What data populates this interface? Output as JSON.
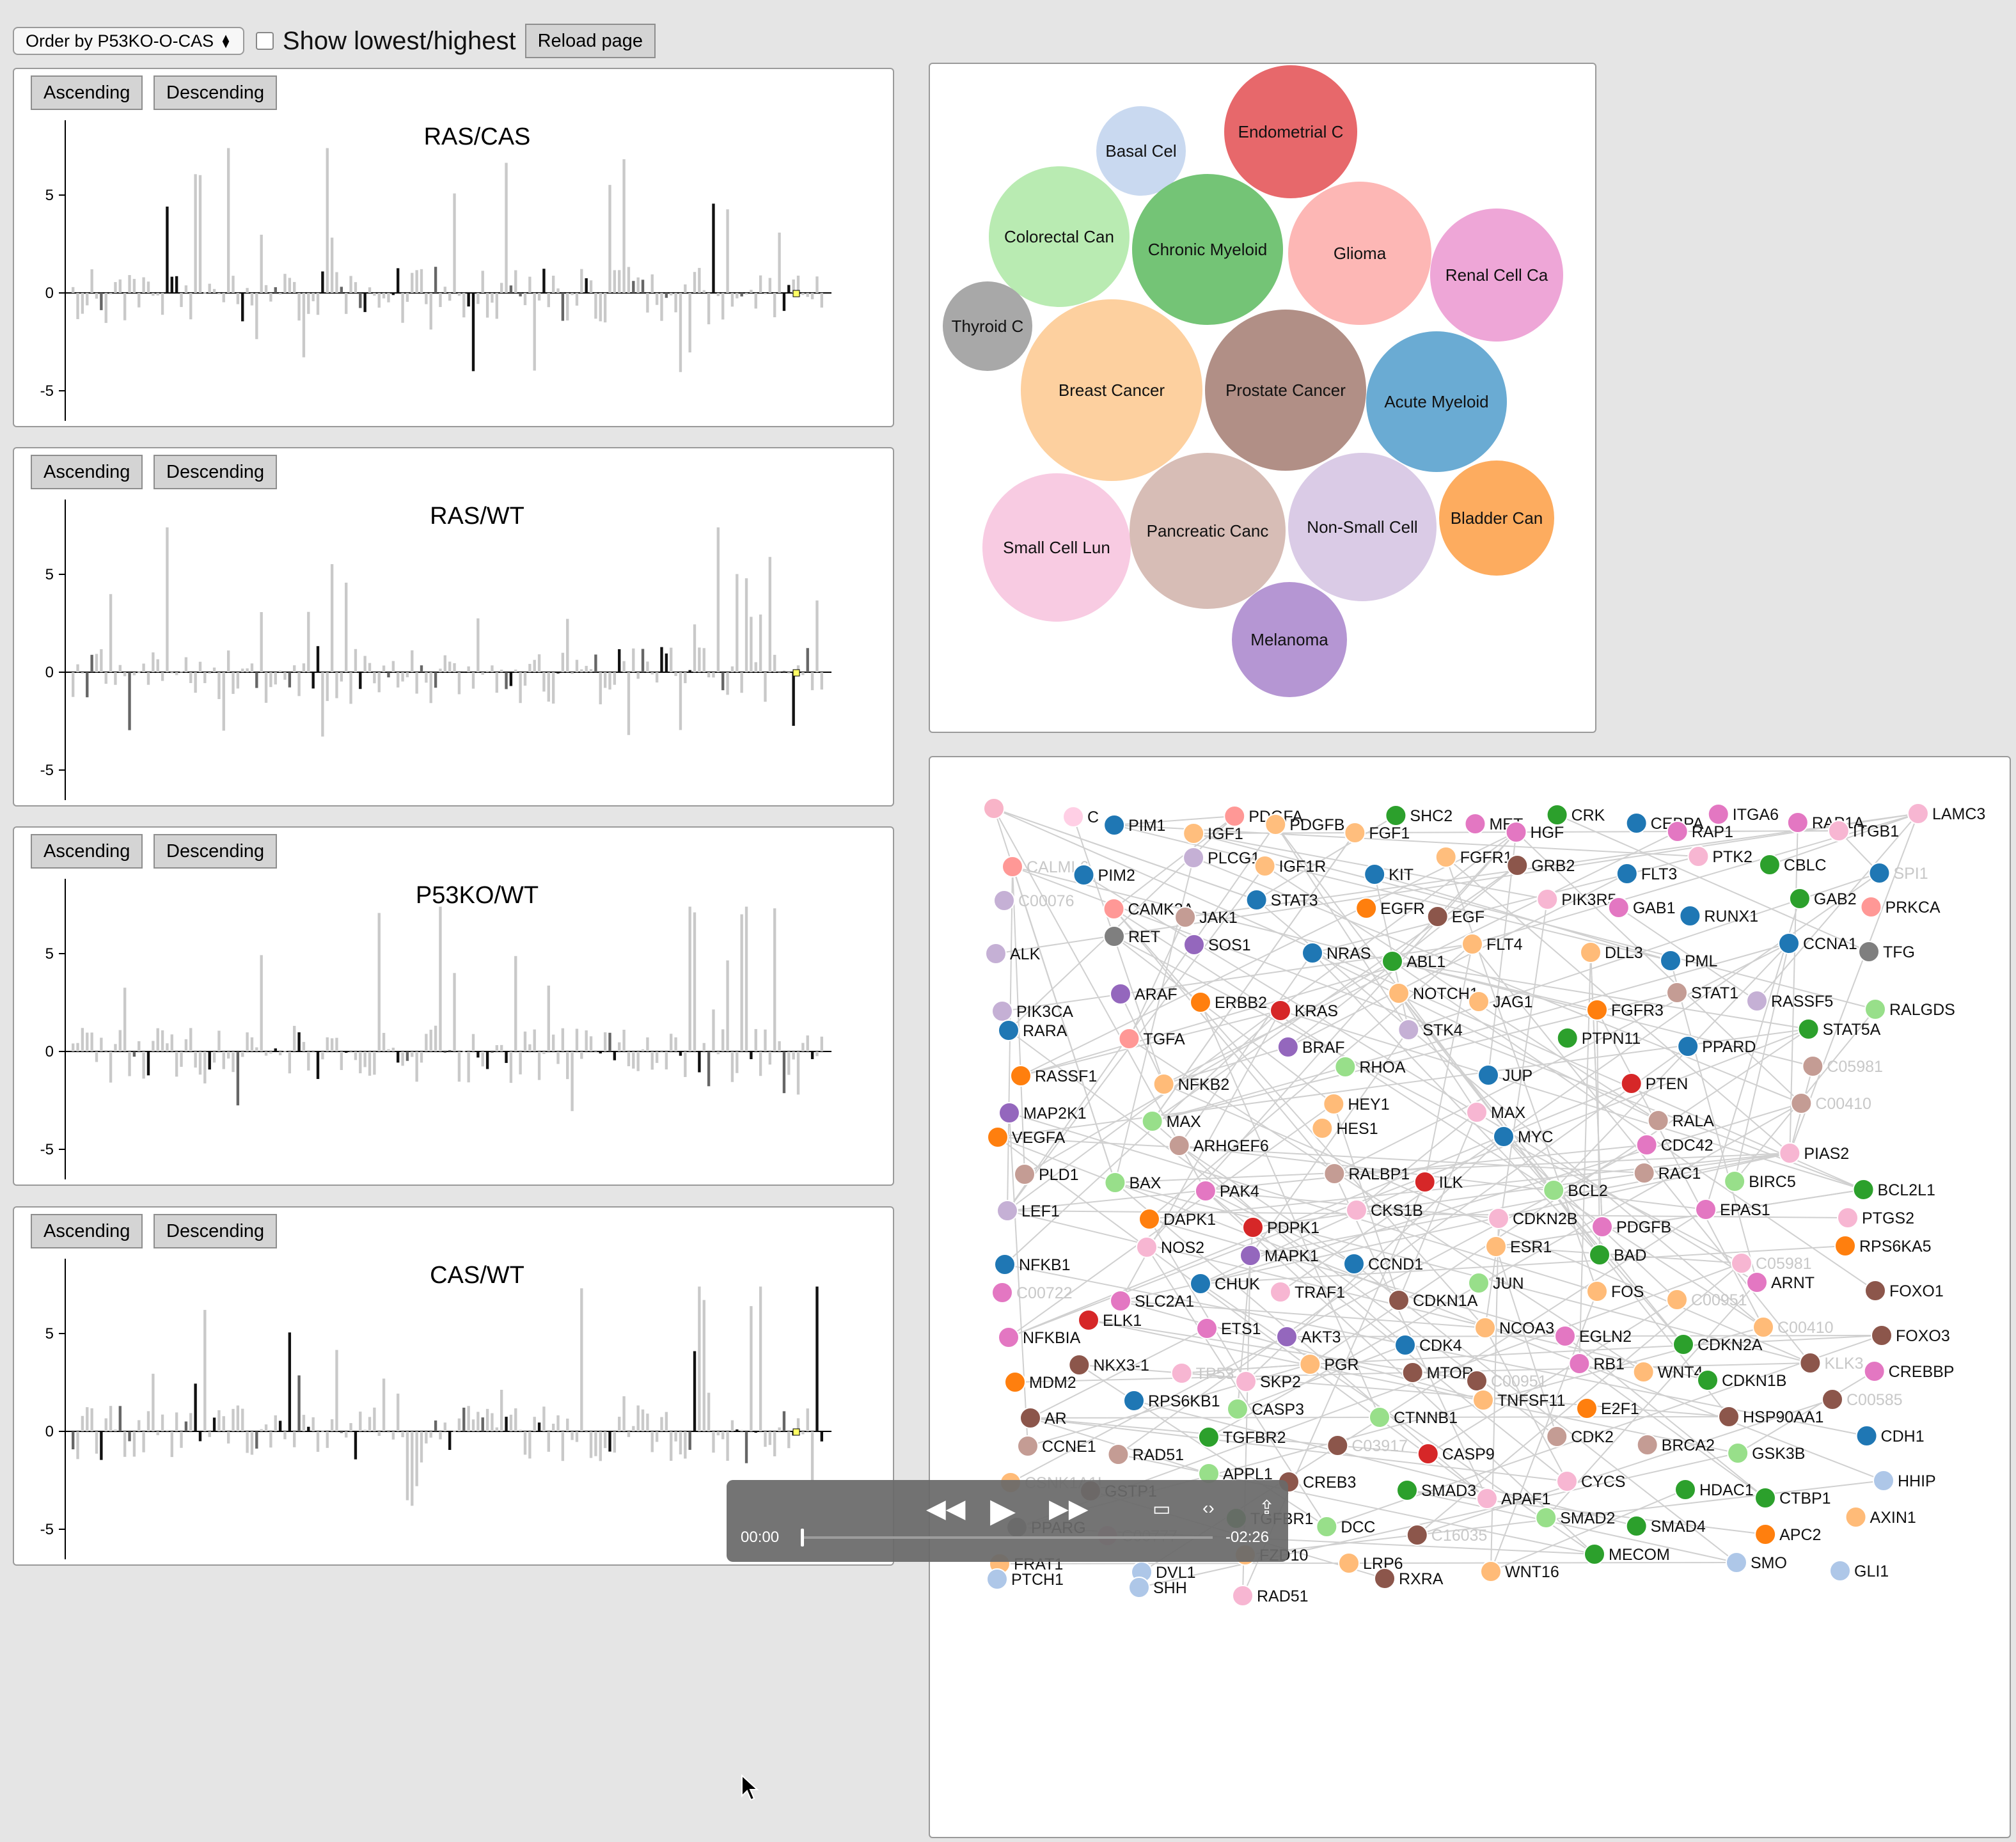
{
  "toolbar": {
    "order_select": "Order by P53KO-O-CAS",
    "show_label": "Show lowest/highest",
    "reload": "Reload page"
  },
  "panels": [
    {
      "id": "ras-cas",
      "title": "RAS/CAS",
      "asc": "Ascending",
      "desc": "Descending"
    },
    {
      "id": "ras-wt",
      "title": "RAS/WT",
      "asc": "Ascending",
      "desc": "Descending"
    },
    {
      "id": "p53ko-wt",
      "title": "P53KO/WT",
      "asc": "Ascending",
      "desc": "Descending"
    },
    {
      "id": "cas-wt",
      "title": "CAS/WT",
      "asc": "Ascending",
      "desc": "Descending"
    }
  ],
  "chart_data": [
    {
      "type": "bar",
      "title": "RAS/CAS",
      "ylim": [
        -8,
        8
      ],
      "yticks": [
        5,
        0,
        -5
      ],
      "seed": 11,
      "highlight": 1
    },
    {
      "type": "bar",
      "title": "RAS/WT",
      "ylim": [
        -8,
        8
      ],
      "yticks": [
        5,
        0,
        -5
      ],
      "seed": 23,
      "highlight": 1
    },
    {
      "type": "bar",
      "title": "P53KO/WT",
      "ylim": [
        -8,
        8
      ],
      "yticks": [
        5,
        0,
        -5
      ],
      "seed": 37,
      "highlight": 0
    },
    {
      "type": "bar",
      "title": "CAS/WT",
      "ylim": [
        -8,
        8
      ],
      "yticks": [
        5,
        0,
        -5
      ],
      "seed": 51,
      "highlight": 1
    }
  ],
  "bubbles": [
    {
      "label": "Endometrial C",
      "color": "#e7686b"
    },
    {
      "label": "Basal Cel",
      "color": "#c9d9f0"
    },
    {
      "label": "Colorectal Can",
      "color": "#b9ebb2"
    },
    {
      "label": "Chronic Myeloid",
      "color": "#74c476"
    },
    {
      "label": "Glioma",
      "color": "#fdb7b5"
    },
    {
      "label": "Renal Cell Ca",
      "color": "#eea6d7"
    },
    {
      "label": "Thyroid C",
      "color": "#a8a8a8"
    },
    {
      "label": "Breast Cancer",
      "color": "#fdd09f"
    },
    {
      "label": "Prostate Cancer",
      "color": "#b18f86"
    },
    {
      "label": "Acute Myeloid",
      "color": "#6aabd3"
    },
    {
      "label": "Small Cell Lun",
      "color": "#f8cbe2"
    },
    {
      "label": "Pancreatic Canc",
      "color": "#d7bdb6"
    },
    {
      "label": "Non-Small Cell",
      "color": "#dacbe6"
    },
    {
      "label": "Bladder Can",
      "color": "#fdac5f"
    },
    {
      "label": "Melanoma",
      "color": "#b596d3"
    }
  ],
  "network_nodes": [
    {
      "label": "",
      "color": "#f8b4c8"
    },
    {
      "label": "C",
      "color": "#ffcfe5"
    },
    {
      "label": "PIM1",
      "color": "#1f77b4"
    },
    {
      "label": "IGF1",
      "color": "#ffbe7d"
    },
    {
      "label": "PDGFA",
      "color": "#ff9896"
    },
    {
      "label": "PDGFB",
      "color": "#ffbe7d"
    },
    {
      "label": "FGF1",
      "color": "#ffbe7d"
    },
    {
      "label": "SHC2",
      "color": "#2ca02c"
    },
    {
      "label": "MET",
      "color": "#e377c2"
    },
    {
      "label": "HGF",
      "color": "#e377c2"
    },
    {
      "label": "CRK",
      "color": "#2ca02c"
    },
    {
      "label": "CEBPA",
      "color": "#1f77b4"
    },
    {
      "label": "RAP1",
      "color": "#e377c2"
    },
    {
      "label": "ITGA6",
      "color": "#e377c2"
    },
    {
      "label": "RAP1A",
      "color": "#e377c2"
    },
    {
      "label": "ITGB1",
      "color": "#f7b6d2"
    },
    {
      "label": "LAMC3",
      "color": "#f7b6d2"
    },
    {
      "label": "CALML6",
      "color": "#ff9896"
    },
    {
      "label": "PIM2",
      "color": "#1f77b4"
    },
    {
      "label": "PLCG1",
      "color": "#c5b0d5"
    },
    {
      "label": "IGF1R",
      "color": "#ffbe7d"
    },
    {
      "label": "KIT",
      "color": "#1f77b4"
    },
    {
      "label": "FGFR1",
      "color": "#ffbe7d"
    },
    {
      "label": "GRB2",
      "color": "#8c564b"
    },
    {
      "label": "FLT3",
      "color": "#1f77b4"
    },
    {
      "label": "PTK2",
      "color": "#f7b6d2"
    },
    {
      "label": "CBLC",
      "color": "#2ca02c"
    },
    {
      "label": "SPI1",
      "color": "#1f77b4"
    },
    {
      "label": "C00076",
      "color": "#c5b0d5"
    },
    {
      "label": "CAMK2A",
      "color": "#ff9896"
    },
    {
      "label": "JAK1",
      "color": "#c49c94"
    },
    {
      "label": "STAT3",
      "color": "#1f77b4"
    },
    {
      "label": "EGFR",
      "color": "#ff7f0e"
    },
    {
      "label": "EGF",
      "color": "#8c564b"
    },
    {
      "label": "PIK3R5",
      "color": "#f7b6d2"
    },
    {
      "label": "GAB1",
      "color": "#e377c2"
    },
    {
      "label": "RUNX1",
      "color": "#1f77b4"
    },
    {
      "label": "GAB2",
      "color": "#2ca02c"
    },
    {
      "label": "PRKCA",
      "color": "#ff9896"
    },
    {
      "label": "ALK",
      "color": "#c5b0d5"
    },
    {
      "label": "RET",
      "color": "#7f7f7f"
    },
    {
      "label": "SOS1",
      "color": "#9467bd"
    },
    {
      "label": "NRAS",
      "color": "#1f77b4"
    },
    {
      "label": "ABL1",
      "color": "#2ca02c"
    },
    {
      "label": "FLT4",
      "color": "#ffbb78"
    },
    {
      "label": "DLL3",
      "color": "#ffbb78"
    },
    {
      "label": "PML",
      "color": "#1f77b4"
    },
    {
      "label": "CCNA1",
      "color": "#1f77b4"
    },
    {
      "label": "TFG",
      "color": "#7f7f7f"
    },
    {
      "label": "PIK3CA",
      "color": "#c5b0d5"
    },
    {
      "label": "ARAF",
      "color": "#9467bd"
    },
    {
      "label": "ERBB2",
      "color": "#ff7f0e"
    },
    {
      "label": "KRAS",
      "color": "#d62728"
    },
    {
      "label": "NOTCH1",
      "color": "#ffbb78"
    },
    {
      "label": "JAG1",
      "color": "#ffbb78"
    },
    {
      "label": "FGFR3",
      "color": "#ff7f0e"
    },
    {
      "label": "STAT1",
      "color": "#c49c94"
    },
    {
      "label": "RASSF5",
      "color": "#c5b0d5"
    },
    {
      "label": "RALGDS",
      "color": "#98df8a"
    },
    {
      "label": "RARA",
      "color": "#1f77b4"
    },
    {
      "label": "TGFA",
      "color": "#ff9896"
    },
    {
      "label": "BRAF",
      "color": "#9467bd"
    },
    {
      "label": "STK4",
      "color": "#c5b0d5"
    },
    {
      "label": "PTPN11",
      "color": "#2ca02c"
    },
    {
      "label": "PPARD",
      "color": "#1f77b4"
    },
    {
      "label": "STAT5A",
      "color": "#2ca02c"
    },
    {
      "label": "RASSF1",
      "color": "#ff7f0e"
    },
    {
      "label": "NFKB2",
      "color": "#ffbb78"
    },
    {
      "label": "RHOA",
      "color": "#98df8a"
    },
    {
      "label": "JUP",
      "color": "#1f77b4"
    },
    {
      "label": "PTEN",
      "color": "#d62728"
    },
    {
      "label": "C05981",
      "color": "#c49c94"
    },
    {
      "label": "MAP2K1",
      "color": "#9467bd"
    },
    {
      "label": "MAX",
      "color": "#98df8a"
    },
    {
      "label": "HEY1",
      "color": "#ffbb78"
    },
    {
      "label": "MAX",
      "color": "#f7b6d2"
    },
    {
      "label": "RALA",
      "color": "#c49c94"
    },
    {
      "label": "C00410",
      "color": "#c49c94"
    },
    {
      "label": "VEGFA",
      "color": "#ff7f0e"
    },
    {
      "label": "ARHGEF6",
      "color": "#c49c94"
    },
    {
      "label": "HES1",
      "color": "#ffbb78"
    },
    {
      "label": "MYC",
      "color": "#1f77b4"
    },
    {
      "label": "CDC42",
      "color": "#e377c2"
    },
    {
      "label": "PIAS2",
      "color": "#f7b6d2"
    },
    {
      "label": "PLD1",
      "color": "#c49c94"
    },
    {
      "label": "BAX",
      "color": "#98df8a"
    },
    {
      "label": "PAK4",
      "color": "#e377c2"
    },
    {
      "label": "RALBP1",
      "color": "#c49c94"
    },
    {
      "label": "ILK",
      "color": "#d62728"
    },
    {
      "label": "BCL2",
      "color": "#98df8a"
    },
    {
      "label": "RAC1",
      "color": "#c49c94"
    },
    {
      "label": "BIRC5",
      "color": "#98df8a"
    },
    {
      "label": "BCL2L1",
      "color": "#2ca02c"
    },
    {
      "label": "LEF1",
      "color": "#c5b0d5"
    },
    {
      "label": "DAPK1",
      "color": "#ff7f0e"
    },
    {
      "label": "PDPK1",
      "color": "#d62728"
    },
    {
      "label": "CKS1B",
      "color": "#f7b6d2"
    },
    {
      "label": "CDKN2B",
      "color": "#f7b6d2"
    },
    {
      "label": "PDGFB",
      "color": "#e377c2"
    },
    {
      "label": "EPAS1",
      "color": "#e377c2"
    },
    {
      "label": "PTGS2",
      "color": "#f7b6d2"
    },
    {
      "label": "NFKB1",
      "color": "#1f77b4"
    },
    {
      "label": "NOS2",
      "color": "#f7b6d2"
    },
    {
      "label": "MAPK1",
      "color": "#9467bd"
    },
    {
      "label": "CCND1",
      "color": "#1f77b4"
    },
    {
      "label": "ESR1",
      "color": "#ffbb78"
    },
    {
      "label": "BAD",
      "color": "#2ca02c"
    },
    {
      "label": "C05981",
      "color": "#f7b6d2"
    },
    {
      "label": "RPS6KA5",
      "color": "#ff7f0e"
    },
    {
      "label": "C00722",
      "color": "#e377c2"
    },
    {
      "label": "SLC2A1",
      "color": "#e377c2"
    },
    {
      "label": "CHUK",
      "color": "#1f77b4"
    },
    {
      "label": "TRAF1",
      "color": "#f7b6d2"
    },
    {
      "label": "CDKN1A",
      "color": "#8c564b"
    },
    {
      "label": "JUN",
      "color": "#98df8a"
    },
    {
      "label": "FOS",
      "color": "#ffbb78"
    },
    {
      "label": "C00951",
      "color": "#ffbb78"
    },
    {
      "label": "ARNT",
      "color": "#e377c2"
    },
    {
      "label": "FOXO1",
      "color": "#8c564b"
    },
    {
      "label": "NFKBIA",
      "color": "#e377c2"
    },
    {
      "label": "ELK1",
      "color": "#d62728"
    },
    {
      "label": "ETS1",
      "color": "#e377c2"
    },
    {
      "label": "AKT3",
      "color": "#9467bd"
    },
    {
      "label": "CDK4",
      "color": "#1f77b4"
    },
    {
      "label": "NCOA3",
      "color": "#ffbb78"
    },
    {
      "label": "EGLN2",
      "color": "#e377c2"
    },
    {
      "label": "CDKN2A",
      "color": "#2ca02c"
    },
    {
      "label": "C00410",
      "color": "#ffbb78"
    },
    {
      "label": "FOXO3",
      "color": "#8c564b"
    },
    {
      "label": "MDM2",
      "color": "#ff7f0e"
    },
    {
      "label": "NKX3-1",
      "color": "#8c564b"
    },
    {
      "label": "TP53",
      "color": "#f7b6d2"
    },
    {
      "label": "SKP2",
      "color": "#f7b6d2"
    },
    {
      "label": "PGR",
      "color": "#ffbb78"
    },
    {
      "label": "MTOR",
      "color": "#8c564b"
    },
    {
      "label": "C00951",
      "color": "#8c564b"
    },
    {
      "label": "RB1",
      "color": "#e377c2"
    },
    {
      "label": "WNT4",
      "color": "#ffbb78"
    },
    {
      "label": "CDKN1B",
      "color": "#2ca02c"
    },
    {
      "label": "KLK3",
      "color": "#8c564b"
    },
    {
      "label": "CREBBP",
      "color": "#e377c2"
    },
    {
      "label": "AR",
      "color": "#8c564b"
    },
    {
      "label": "RPS6KB1",
      "color": "#1f77b4"
    },
    {
      "label": "CASP3",
      "color": "#98df8a"
    },
    {
      "label": "CTNNB1",
      "color": "#98df8a"
    },
    {
      "label": "TNFSF11",
      "color": "#ffbb78"
    },
    {
      "label": "E2F1",
      "color": "#ff7f0e"
    },
    {
      "label": "HSP90AA1",
      "color": "#8c564b"
    },
    {
      "label": "C00585",
      "color": "#8c564b"
    },
    {
      "label": "CCNE1",
      "color": "#c49c94"
    },
    {
      "label": "RAD51",
      "color": "#c49c94"
    },
    {
      "label": "TGFBR2",
      "color": "#2ca02c"
    },
    {
      "label": "C03917",
      "color": "#8c564b"
    },
    {
      "label": "CASP9",
      "color": "#d62728"
    },
    {
      "label": "CDK2",
      "color": "#c49c94"
    },
    {
      "label": "BRCA2",
      "color": "#c49c94"
    },
    {
      "label": "GSK3B",
      "color": "#98df8a"
    },
    {
      "label": "CDH1",
      "color": "#1f77b4"
    },
    {
      "label": "CSNK1A1L",
      "color": "#ffbb78"
    },
    {
      "label": "GSTP1",
      "color": "#8c564b"
    },
    {
      "label": "APPL1",
      "color": "#98df8a"
    },
    {
      "label": "CREB3",
      "color": "#8c564b"
    },
    {
      "label": "SMAD3",
      "color": "#2ca02c"
    },
    {
      "label": "APAF1",
      "color": "#f7b6d2"
    },
    {
      "label": "CYCS",
      "color": "#f7b6d2"
    },
    {
      "label": "HDAC1",
      "color": "#2ca02c"
    },
    {
      "label": "CTBP1",
      "color": "#2ca02c"
    },
    {
      "label": "HHIP",
      "color": "#aec7e8"
    },
    {
      "label": "PPARG",
      "color": "#7f7f7f"
    },
    {
      "label": "C00777",
      "color": "#f7b6d2"
    },
    {
      "label": "TGFBR1",
      "color": "#2ca02c"
    },
    {
      "label": "DCC",
      "color": "#98df8a"
    },
    {
      "label": "C16035",
      "color": "#8c564b"
    },
    {
      "label": "SMAD2",
      "color": "#98df8a"
    },
    {
      "label": "SMAD4",
      "color": "#2ca02c"
    },
    {
      "label": "APC2",
      "color": "#ff7f0e"
    },
    {
      "label": "AXIN1",
      "color": "#ffbb78"
    },
    {
      "label": "FRAT1",
      "color": "#ffbb78"
    },
    {
      "label": "DVL1",
      "color": "#aec7e8"
    },
    {
      "label": "FZD10",
      "color": "#ffbb78"
    },
    {
      "label": "LRP6",
      "color": "#ffbb78"
    },
    {
      "label": "WNT16",
      "color": "#ffbb78"
    },
    {
      "label": "MECOM",
      "color": "#2ca02c"
    },
    {
      "label": "SMO",
      "color": "#aec7e8"
    },
    {
      "label": "GLI1",
      "color": "#aec7e8"
    },
    {
      "label": "PTCH1",
      "color": "#aec7e8"
    },
    {
      "label": "SHH",
      "color": "#aec7e8"
    },
    {
      "label": "RAD51",
      "color": "#f7b6d2"
    },
    {
      "label": "RXRA",
      "color": "#8c564b"
    }
  ],
  "video": {
    "time_current": "00:00",
    "time_remaining": "-02:26"
  }
}
